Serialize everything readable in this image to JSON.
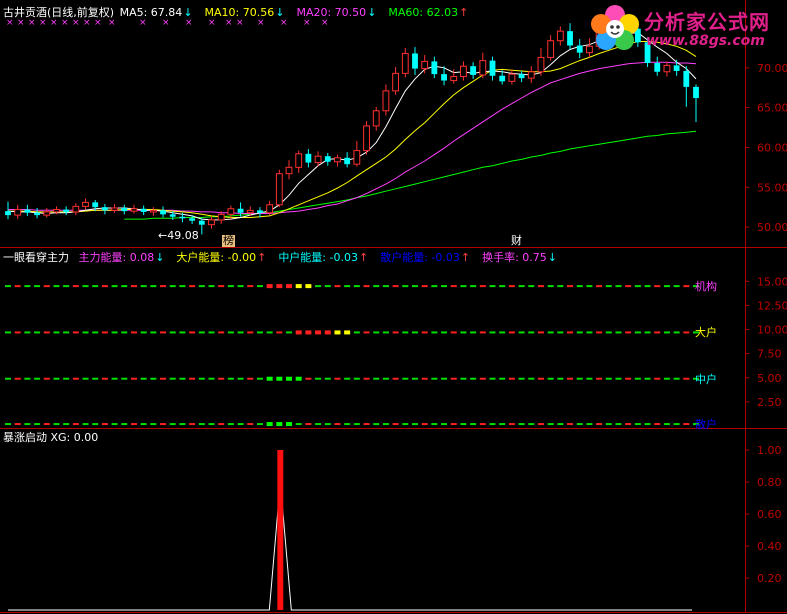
{
  "logo": {
    "title": "分析家公式网",
    "url": "www.88gs.com"
  },
  "main_panel": {
    "title": "古井贡酒(日线,前复权)",
    "ma": [
      {
        "label": "MA5: 67.84",
        "arrow": "↓",
        "color": "#ffffff",
        "arrow_color": "#00ffff"
      },
      {
        "label": "MA10: 70.56",
        "arrow": "↓",
        "color": "#ffff00",
        "arrow_color": "#00ffff"
      },
      {
        "label": "MA20: 70.50",
        "arrow": "↓",
        "color": "#ff40ff",
        "arrow_color": "#00ffff"
      },
      {
        "label": "MA60: 62.03",
        "arrow": "↑",
        "color": "#00ff00",
        "arrow_color": "#ff4040"
      }
    ],
    "low_label": "49.08",
    "marker_bang": "榜",
    "marker_cai": "财"
  },
  "mid_panel": {
    "title": "一眼看穿主力",
    "items": [
      {
        "label": "主力能量: 0.08",
        "arrow": "↓",
        "color": "#ff40ff",
        "arrow_color": "#00ffff"
      },
      {
        "label": "大户能量: -0.00",
        "arrow": "↑",
        "color": "#ffff00",
        "arrow_color": "#ff4040"
      },
      {
        "label": "中户能量: -0.03",
        "arrow": "↑",
        "color": "#00ffff",
        "arrow_color": "#ff4040"
      },
      {
        "label": "散户能量: -0.03",
        "arrow": "↑",
        "color": "#0000ff",
        "arrow_color": "#ff4040"
      },
      {
        "label": "换手率: 0.75",
        "arrow": "↓",
        "color": "#ff40ff",
        "arrow_color": "#00ffff"
      }
    ],
    "row_labels": [
      "机构",
      "大户",
      "中户",
      "散户"
    ]
  },
  "bottom_panel": {
    "title": "暴涨启动 XG: 0.00"
  },
  "chart_data": [
    {
      "type": "candlestick",
      "title": "古井贡酒(日线,前复权)",
      "y_ticks": [
        "70.00",
        "65.00",
        "60.00",
        "55.00",
        "50.00"
      ],
      "ylim": [
        48,
        76
      ],
      "candles": [
        [
          52.0,
          51.5,
          53.2,
          51.0
        ],
        [
          51.5,
          52.2,
          52.8,
          51.0
        ],
        [
          52.2,
          51.8,
          52.8,
          51.4
        ],
        [
          51.8,
          51.5,
          52.4,
          51.1
        ],
        [
          51.5,
          51.9,
          52.4,
          51.2
        ],
        [
          51.9,
          52.2,
          52.6,
          51.6
        ],
        [
          52.2,
          51.9,
          52.6,
          51.5
        ],
        [
          51.9,
          52.6,
          53.0,
          51.5
        ],
        [
          52.6,
          53.1,
          53.6,
          52.2
        ],
        [
          53.1,
          52.5,
          53.4,
          52.0
        ],
        [
          52.5,
          52.1,
          52.9,
          51.6
        ],
        [
          52.1,
          52.4,
          52.9,
          51.8
        ],
        [
          52.4,
          52.0,
          52.8,
          51.6
        ],
        [
          52.0,
          52.3,
          52.8,
          51.7
        ],
        [
          52.3,
          51.9,
          52.7,
          51.5
        ],
        [
          51.9,
          52.1,
          52.5,
          51.4
        ],
        [
          52.1,
          51.6,
          52.6,
          51.2
        ],
        [
          51.6,
          51.3,
          52.0,
          50.9
        ],
        [
          51.3,
          51.1,
          51.8,
          50.6
        ],
        [
          51.1,
          50.8,
          51.5,
          50.4
        ],
        [
          50.8,
          50.3,
          51.2,
          49.08
        ],
        [
          50.3,
          50.9,
          51.4,
          49.8
        ],
        [
          50.9,
          51.6,
          52.0,
          50.4
        ],
        [
          51.6,
          52.3,
          52.7,
          51.0
        ],
        [
          52.3,
          51.8,
          53.1,
          51.3
        ],
        [
          51.8,
          52.1,
          52.6,
          51.4
        ],
        [
          52.1,
          51.8,
          52.5,
          51.2
        ],
        [
          51.8,
          52.8,
          53.3,
          51.5
        ],
        [
          52.8,
          56.7,
          57.2,
          52.5
        ],
        [
          56.7,
          57.5,
          58.4,
          56.0
        ],
        [
          57.5,
          59.2,
          59.6,
          56.8
        ],
        [
          59.2,
          58.1,
          59.8,
          57.5
        ],
        [
          58.1,
          58.9,
          59.5,
          57.6
        ],
        [
          58.9,
          58.2,
          59.3,
          57.7
        ],
        [
          58.2,
          58.7,
          59.1,
          57.6
        ],
        [
          58.7,
          57.9,
          59.4,
          57.5
        ],
        [
          57.9,
          59.6,
          60.8,
          57.6
        ],
        [
          59.6,
          62.7,
          63.3,
          59.1
        ],
        [
          62.7,
          64.6,
          65.1,
          62.1
        ],
        [
          64.6,
          67.1,
          67.9,
          64.0
        ],
        [
          67.1,
          69.3,
          70.1,
          66.6
        ],
        [
          69.3,
          71.8,
          72.5,
          68.8
        ],
        [
          71.8,
          69.9,
          72.6,
          69.1
        ],
        [
          69.9,
          70.8,
          71.6,
          69.3
        ],
        [
          70.8,
          69.2,
          71.4,
          68.7
        ],
        [
          69.2,
          68.4,
          70.2,
          67.8
        ],
        [
          68.4,
          68.9,
          69.8,
          68.0
        ],
        [
          68.9,
          70.2,
          70.8,
          68.4
        ],
        [
          70.2,
          69.1,
          70.7,
          68.6
        ],
        [
          69.1,
          70.9,
          71.9,
          68.7
        ],
        [
          70.9,
          69.0,
          71.4,
          68.4
        ],
        [
          69.0,
          68.3,
          69.7,
          67.9
        ],
        [
          68.3,
          69.2,
          69.8,
          67.9
        ],
        [
          69.2,
          68.7,
          69.6,
          68.2
        ],
        [
          68.7,
          69.5,
          70.2,
          68.1
        ],
        [
          69.5,
          71.3,
          72.5,
          69.0
        ],
        [
          71.3,
          73.4,
          74.1,
          70.9
        ],
        [
          73.4,
          74.6,
          75.2,
          72.8
        ],
        [
          74.6,
          72.8,
          75.6,
          72.3
        ],
        [
          72.8,
          71.9,
          73.6,
          71.2
        ],
        [
          71.9,
          72.7,
          73.7,
          71.3
        ],
        [
          72.7,
          75.1,
          75.7,
          72.3
        ],
        [
          75.1,
          73.8,
          75.6,
          73.3
        ],
        [
          73.8,
          74.5,
          75.2,
          73.5
        ],
        [
          74.5,
          74.9,
          75.6,
          74.0
        ],
        [
          74.9,
          73.2,
          75.4,
          72.6
        ],
        [
          73.2,
          70.6,
          73.8,
          70.1
        ],
        [
          70.6,
          69.5,
          71.4,
          69.0
        ],
        [
          69.5,
          70.3,
          70.8,
          68.9
        ],
        [
          70.3,
          69.6,
          71.0,
          69.0
        ],
        [
          69.6,
          67.6,
          70.2,
          65.1
        ],
        [
          67.6,
          66.2,
          67.9,
          63.2
        ]
      ],
      "ma5": [
        52.0,
        51.9,
        51.9,
        51.8,
        51.7,
        51.8,
        51.8,
        51.9,
        52.1,
        52.3,
        52.4,
        52.4,
        52.4,
        52.3,
        52.1,
        52.1,
        52.0,
        51.8,
        51.6,
        51.4,
        51.0,
        50.9,
        50.9,
        51.0,
        51.2,
        51.5,
        51.8,
        52.0,
        52.8,
        54.0,
        55.5,
        56.6,
        57.7,
        58.5,
        58.6,
        58.4,
        58.7,
        59.4,
        60.6,
        62.6,
        64.9,
        67.1,
        68.6,
        69.8,
        70.2,
        70.0,
        69.4,
        69.5,
        69.3,
        69.5,
        69.6,
        69.5,
        69.3,
        69.2,
        69.1,
        69.4,
        70.4,
        71.5,
        72.3,
        72.7,
        72.9,
        73.4,
        73.7,
        74.0,
        74.3,
        74.4,
        73.5,
        72.6,
        71.8,
        70.7,
        69.9,
        68.6
      ],
      "ma10": [
        52.0,
        52.0,
        52.0,
        51.9,
        51.9,
        51.9,
        51.9,
        51.9,
        52.0,
        52.1,
        52.1,
        52.1,
        52.2,
        52.2,
        52.2,
        52.2,
        52.1,
        52.0,
        51.9,
        51.8,
        51.6,
        51.4,
        51.3,
        51.2,
        51.2,
        51.2,
        51.3,
        51.4,
        51.8,
        52.3,
        52.8,
        53.3,
        53.8,
        54.3,
        54.9,
        55.6,
        56.4,
        57.2,
        58.0,
        58.8,
        59.8,
        61.0,
        62.1,
        63.1,
        64.3,
        65.5,
        66.6,
        67.5,
        68.3,
        69.1,
        69.7,
        69.8,
        69.7,
        69.6,
        69.5,
        69.5,
        69.6,
        69.9,
        70.4,
        70.9,
        71.3,
        71.8,
        72.2,
        72.6,
        73.0,
        73.3,
        73.3,
        73.2,
        73.0,
        72.7,
        72.2,
        71.4
      ],
      "ma20": [
        52.2,
        52.2,
        52.2,
        52.1,
        52.1,
        52.1,
        52.1,
        52.1,
        52.1,
        52.1,
        52.1,
        52.1,
        52.1,
        52.1,
        52.1,
        52.1,
        52.1,
        52.1,
        52.0,
        52.0,
        51.9,
        51.9,
        51.8,
        51.8,
        51.7,
        51.7,
        51.7,
        51.7,
        51.8,
        51.9,
        52.0,
        52.2,
        52.4,
        52.7,
        52.9,
        53.3,
        53.7,
        54.2,
        54.8,
        55.4,
        56.1,
        56.9,
        57.6,
        58.3,
        59.1,
        59.9,
        60.8,
        61.6,
        62.4,
        63.2,
        64.0,
        64.8,
        65.5,
        66.2,
        66.9,
        67.5,
        68.1,
        68.5,
        68.9,
        69.3,
        69.6,
        69.9,
        70.1,
        70.3,
        70.5,
        70.6,
        70.7,
        70.7,
        70.7,
        70.6,
        70.6,
        70.5
      ],
      "ma60": [
        null,
        null,
        null,
        null,
        null,
        null,
        null,
        null,
        null,
        null,
        null,
        null,
        51.0,
        51.0,
        51.0,
        51.1,
        51.1,
        51.1,
        51.2,
        51.2,
        51.2,
        51.3,
        51.3,
        51.4,
        51.5,
        51.6,
        51.7,
        51.8,
        52.0,
        52.2,
        52.4,
        52.6,
        52.8,
        53.0,
        53.2,
        53.4,
        53.7,
        53.9,
        54.2,
        54.5,
        54.8,
        55.1,
        55.4,
        55.7,
        56.0,
        56.3,
        56.6,
        56.9,
        57.2,
        57.5,
        57.7,
        58.0,
        58.3,
        58.5,
        58.8,
        59.0,
        59.3,
        59.5,
        59.8,
        60.0,
        60.2,
        60.4,
        60.6,
        60.8,
        61.0,
        61.2,
        61.4,
        61.5,
        61.7,
        61.8,
        61.9,
        62.03
      ]
    },
    {
      "type": "bar",
      "title": "一眼看穿主力",
      "y_ticks": [
        "15.00",
        "12.50",
        "10.00",
        "7.50",
        "5.00",
        "2.50"
      ],
      "ylim": [
        0,
        17
      ],
      "rows": [
        {
          "name": "机构",
          "level": 14.5,
          "color": "#ff40ff",
          "hot": {
            "yellow": [
              30,
              31
            ],
            "red": [
              27,
              28,
              29
            ]
          }
        },
        {
          "name": "大户",
          "level": 9.7,
          "color": "#ffff00",
          "hot": {
            "yellow": [
              34,
              35
            ],
            "red": [
              30,
              31,
              32,
              33
            ]
          }
        },
        {
          "name": "中户",
          "level": 4.9,
          "color": "#00ffff",
          "hot": {
            "green": [
              27,
              28,
              29,
              30
            ],
            "red": []
          }
        },
        {
          "name": "散户",
          "level": 0.2,
          "color": "#0000ff",
          "hot": {
            "green": [
              27,
              28,
              29
            ],
            "red": []
          }
        }
      ]
    },
    {
      "type": "line",
      "title": "暴涨启动 XG: 0.00",
      "y_ticks": [
        "1.00",
        "0.80",
        "0.60",
        "0.40",
        "0.20"
      ],
      "ylim": [
        0,
        1.05
      ],
      "spike_index": 28,
      "spike_value": 1.0
    }
  ],
  "colors": {
    "axis": "#b00000",
    "up": "#ff3030",
    "down": "#00ffff",
    "bg": "#000000"
  }
}
